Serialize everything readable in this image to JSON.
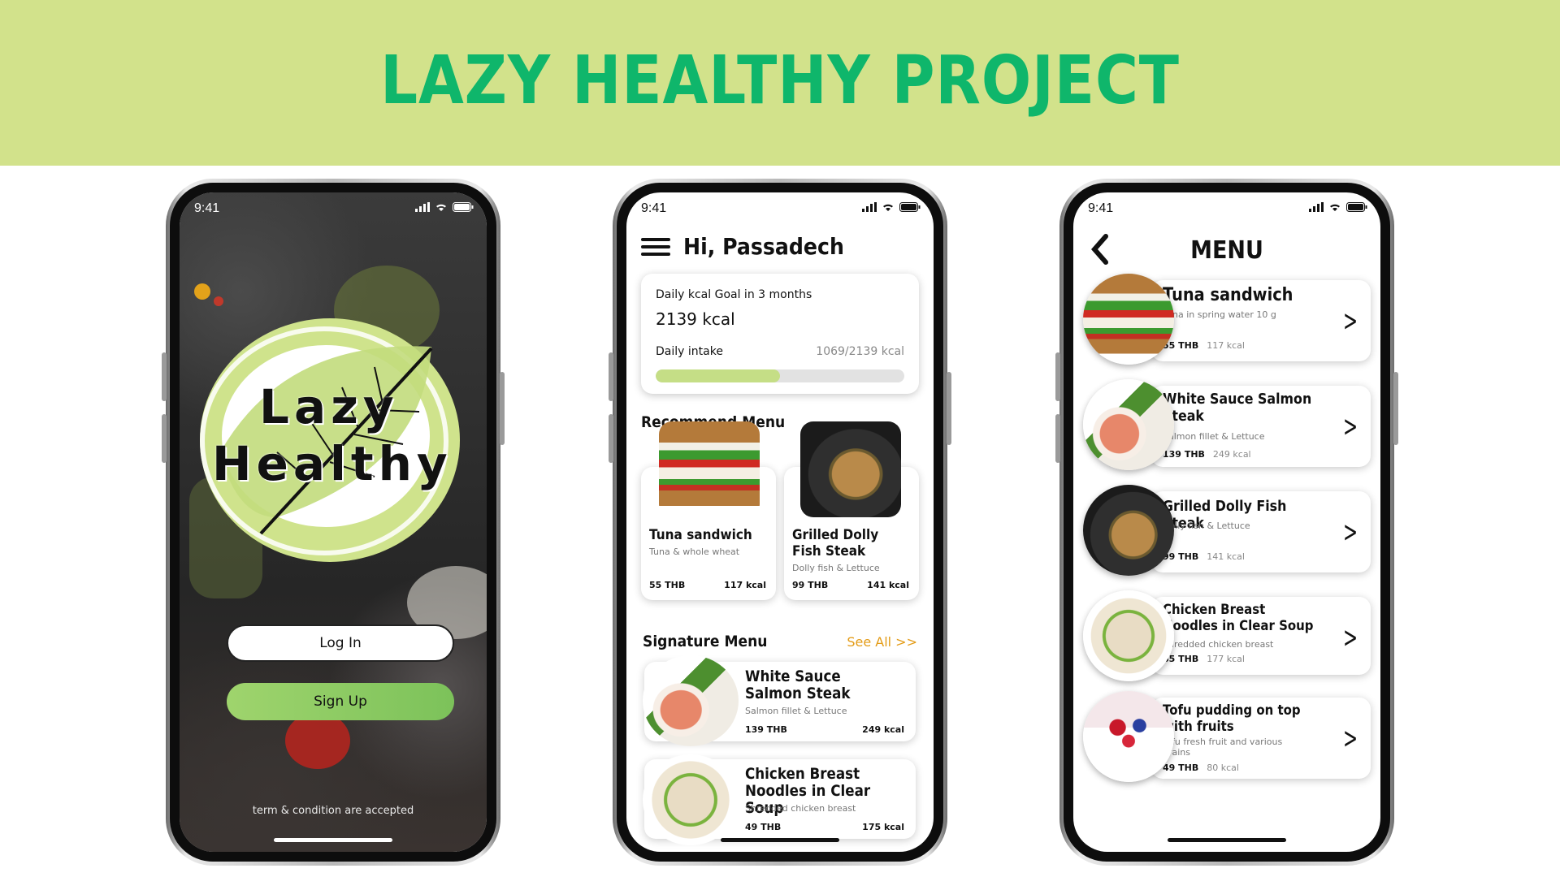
{
  "banner": {
    "title": "LAZY HEALTHY PROJECT"
  },
  "colors": {
    "banner_bg": "#d2e28b",
    "title_green": "#0fb66b",
    "accent_green": "#9fd46d",
    "see_all_orange": "#e39b16"
  },
  "status_bar": {
    "time": "9:41",
    "icons": [
      "signal-icon",
      "wifi-icon",
      "battery-icon"
    ]
  },
  "welcome": {
    "logo_line1": "Lazy",
    "logo_line2": "Healthy",
    "login_label": "Log In",
    "signup_label": "Sign Up",
    "terms": "term & condition are accepted"
  },
  "home": {
    "greeting": "Hi, Passadech",
    "goal_label": "Daily kcal Goal in 3 months",
    "goal_value": "2139 kcal",
    "intake_label": "Daily intake",
    "intake_value": "1069/2139 kcal",
    "intake_fraction": 0.4998,
    "recommend_title": "Recommend Menu",
    "recommend": [
      {
        "name": "Tuna sandwich",
        "desc": "Tuna & whole wheat",
        "price": "55 THB",
        "kcal": "117 kcal",
        "image": "sandwich-image"
      },
      {
        "name": "Grilled Dolly Fish Steak",
        "desc": "Dolly fish & Lettuce",
        "price": "99 THB",
        "kcal": "141 kcal",
        "image": "fish-steak-image"
      }
    ],
    "signature_title": "Signature Menu",
    "see_all": "See All >>",
    "signature": [
      {
        "name": "White Sauce Salmon Steak",
        "desc": "Salmon fillet & Lettuce",
        "price": "139 THB",
        "kcal": "249 kcal",
        "image": "salmon-image"
      },
      {
        "name": "Chicken Breast Noodles in Clear Soup",
        "desc": "Shredded chicken breast",
        "price": "49 THB",
        "kcal": "175 kcal",
        "image": "noodle-soup-image"
      }
    ]
  },
  "menu": {
    "title": "MENU",
    "items": [
      {
        "name": "Tuna sandwich",
        "desc": "Tuna in spring water 10 g",
        "price": "55",
        "currency": "THB",
        "kcal": "117 kcal",
        "image": "sandwich-image"
      },
      {
        "name": "White Sauce Salmon Steak",
        "desc": "Salmon fillet & Lettuce",
        "price": "139",
        "currency": "THB",
        "kcal": "249 kcal",
        "image": "salmon-image"
      },
      {
        "name": "Grilled Dolly Fish Steak",
        "desc": "Dolly fish & Lettuce",
        "price": "99",
        "currency": "THB",
        "kcal": "141 kcal",
        "image": "fish-steak-image"
      },
      {
        "name": "Chicken Breast Noodles in Clear Soup",
        "desc": "Shredded chicken breast",
        "price": "65",
        "currency": "THB",
        "kcal": "177 kcal",
        "image": "noodle-soup-image"
      },
      {
        "name": "Tofu pudding on top with fruits",
        "desc": "tofu fresh fruit and various grains",
        "price": "49",
        "currency": "THB",
        "kcal": "80 kcal",
        "image": "tofu-pudding-image"
      }
    ]
  }
}
